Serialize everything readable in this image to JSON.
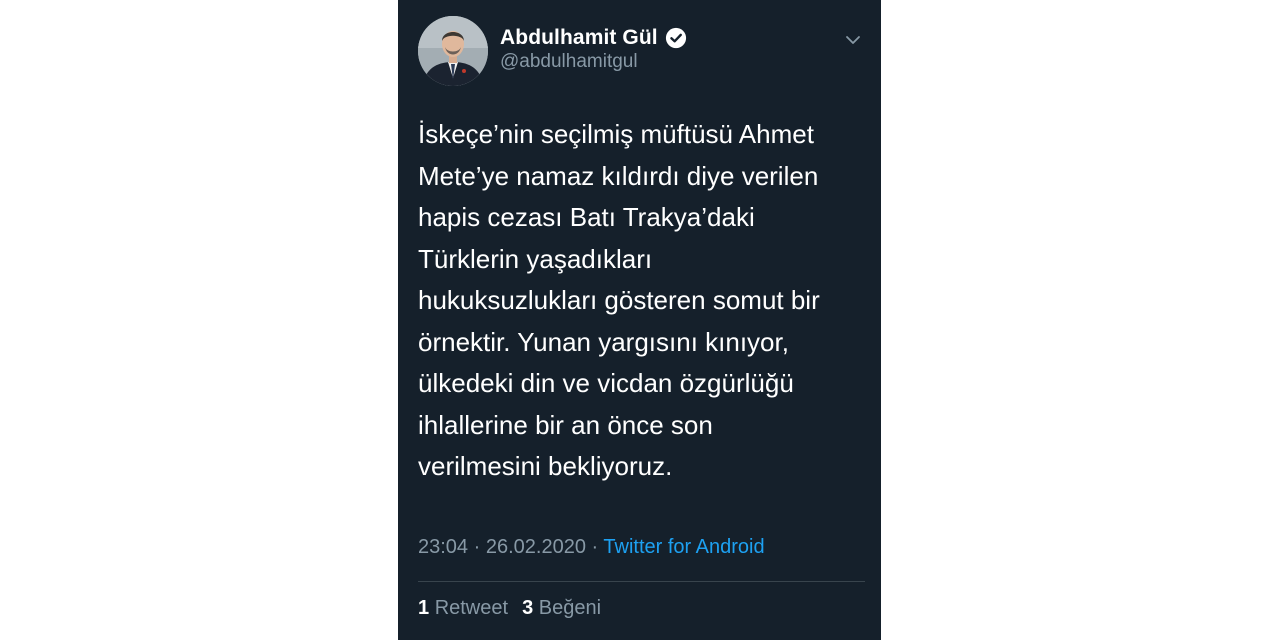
{
  "user": {
    "display_name": "Abdulhamit Gül",
    "handle": "@abdulhamitgul"
  },
  "icons": {
    "verified": "verified-badge-icon",
    "menu": "chevron-down-icon"
  },
  "tweet": {
    "text": "İskeçe’nin seçilmiş müftüsü Ahmet\nMete’ye namaz kıldırdı diye verilen\nhapis cezası Batı Trakya’daki\nTürklerin yaşadıkları\nhukuksuzlukları gösteren somut bir\nörnektir. Yunan yargısını kınıyor,\nülkedeki din ve vicdan özgürlüğü\nihlallerine bir an önce son\nverilmesini bekliyoruz.",
    "time": "23:04",
    "separator": "·",
    "date": "26.02.2020",
    "source": "Twitter for Android"
  },
  "stats": {
    "retweet_count": "1",
    "retweet_label": "Retweet",
    "like_count": "3",
    "like_label": "Beğeni"
  },
  "colors": {
    "background": "#15202b",
    "text": "#ffffff",
    "muted": "#8899a6",
    "link": "#1da1f2",
    "divider": "#38444d"
  }
}
